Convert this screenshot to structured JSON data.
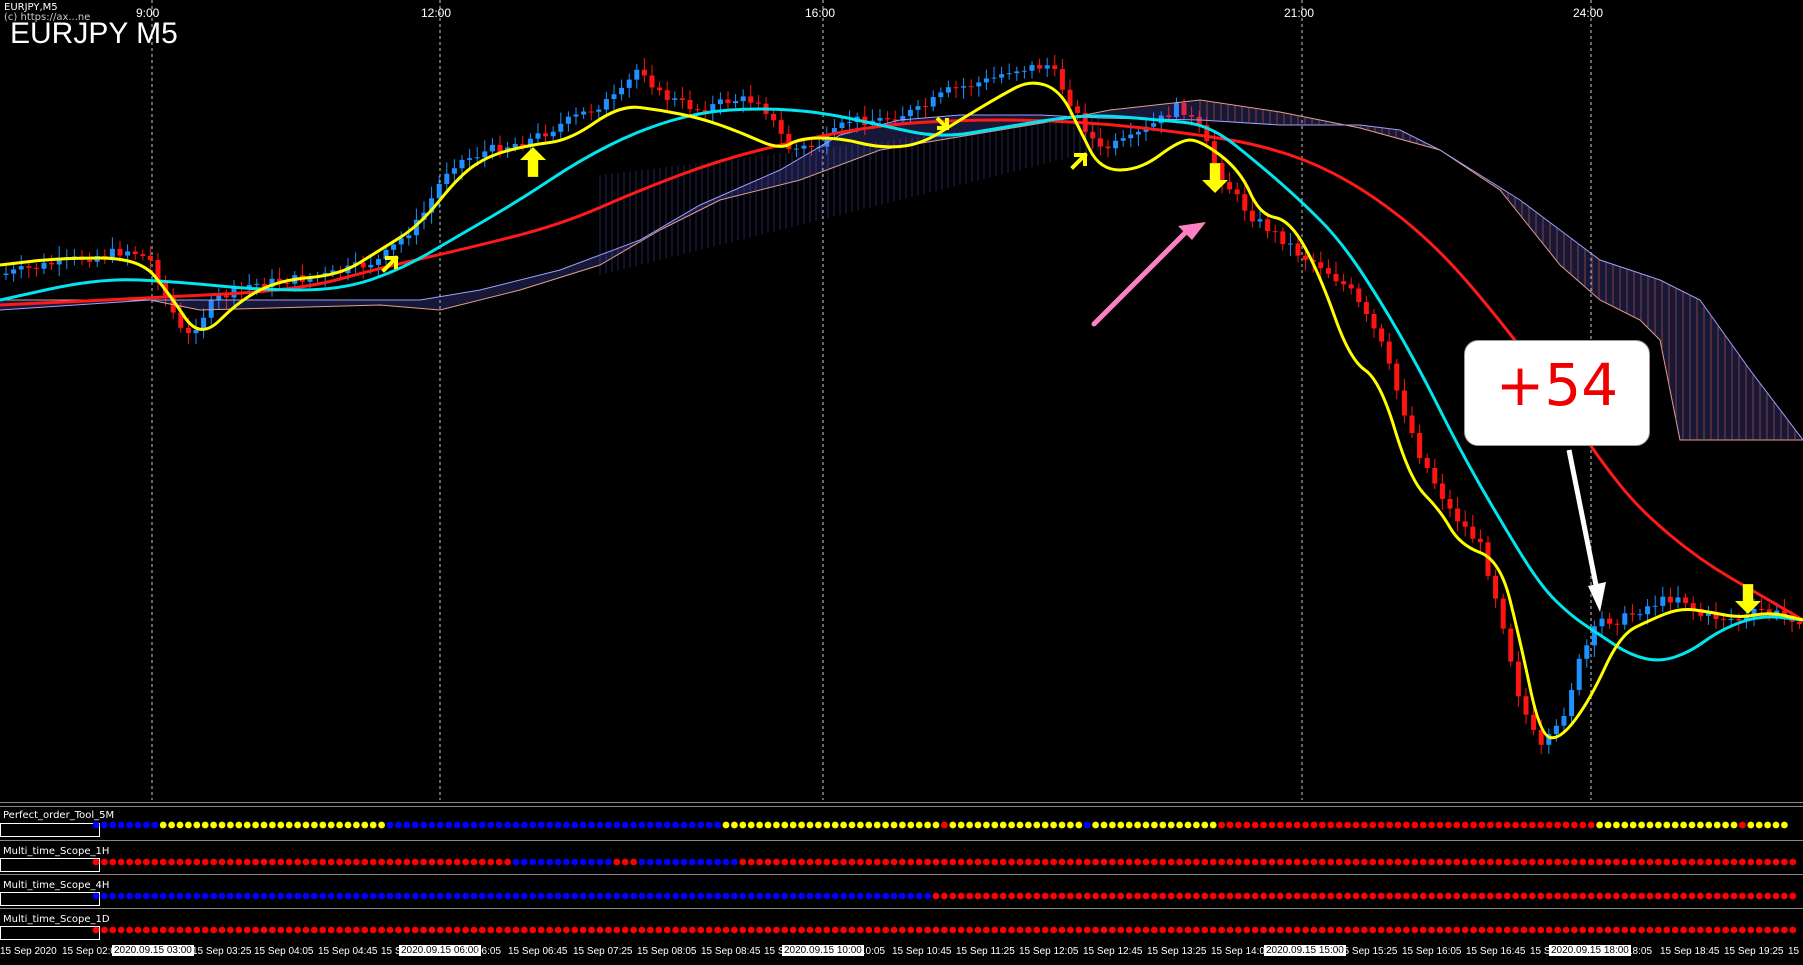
{
  "window": {
    "symbol_label": "EURJPY,M5",
    "copyright": "(c) https://ax...ne",
    "title": "EURJPY M5"
  },
  "time_labels": [
    "9:00",
    "12:00",
    "16:00",
    "21:00",
    "24:00"
  ],
  "callout": {
    "text": "+54"
  },
  "colors": {
    "bull": "#1e90ff",
    "bear": "#ff1414",
    "ma_fast": "#ffff00",
    "ma_mid": "#00e5ee",
    "ma_slow": "#ff1a1a",
    "cloud_up": "#6a6aff",
    "cloud_down": "#d06040",
    "dot_blue": "#0000ff",
    "dot_yellow": "#ffff00",
    "dot_red": "#ff0000"
  },
  "subwindows": [
    {
      "label": "Perfect_order_Tool_5M",
      "segments": [
        [
          "blue",
          8
        ],
        [
          "yellow",
          27
        ],
        [
          "blue",
          40
        ],
        [
          "yellow",
          26
        ],
        [
          "red",
          1
        ],
        [
          "yellow",
          16
        ],
        [
          "blue",
          1
        ],
        [
          "yellow",
          15
        ],
        [
          "red",
          45
        ],
        [
          "yellow",
          17
        ],
        [
          "red",
          1
        ],
        [
          "yellow",
          5
        ]
      ]
    },
    {
      "label": "Multi_time_Scope_1H",
      "segments": [
        [
          "red",
          50
        ],
        [
          "blue",
          12
        ],
        [
          "red",
          3
        ],
        [
          "blue",
          12
        ],
        [
          "red",
          126
        ]
      ]
    },
    {
      "label": "Multi_time_Scope_4H",
      "segments": [
        [
          "blue",
          100
        ],
        [
          "red",
          103
        ]
      ]
    },
    {
      "label": "Multi_time_Scope_1D",
      "segments": [
        [
          "red",
          203
        ]
      ]
    }
  ],
  "x_axis": [
    {
      "text": "15 Sep 2020",
      "boxed": false
    },
    {
      "text": "15 Sep 02:05",
      "boxed": false
    },
    {
      "text": "2020.09.15 03:00",
      "boxed": true
    },
    {
      "text": "15 Sep 03:25",
      "boxed": false
    },
    {
      "text": "15 Sep 04:05",
      "boxed": false
    },
    {
      "text": "15 Sep 04:45",
      "boxed": false
    },
    {
      "text": "15 S",
      "boxed": false
    },
    {
      "text": "2020.09.15 06:00",
      "boxed": true
    },
    {
      "text": "06:05",
      "boxed": false
    },
    {
      "text": "15 Sep 06:45",
      "boxed": false
    },
    {
      "text": "15 Sep 07:25",
      "boxed": false
    },
    {
      "text": "15 Sep 08:05",
      "boxed": false
    },
    {
      "text": "15 Sep 08:45",
      "boxed": false
    },
    {
      "text": "15 S",
      "boxed": false
    },
    {
      "text": "2020.09.15 10:00",
      "boxed": true
    },
    {
      "text": "10:05",
      "boxed": false
    },
    {
      "text": "15 Sep 10:45",
      "boxed": false
    },
    {
      "text": "15 Sep 11:25",
      "boxed": false
    },
    {
      "text": "15 Sep 12:05",
      "boxed": false
    },
    {
      "text": "15 Sep 12:45",
      "boxed": false
    },
    {
      "text": "15 Sep 13:25",
      "boxed": false
    },
    {
      "text": "15 Sep 14:0",
      "boxed": false
    },
    {
      "text": "2020.09.15 15:00",
      "boxed": true
    },
    {
      "text": "15 Sep 15:25",
      "boxed": false
    },
    {
      "text": "15 Sep 16:05",
      "boxed": false
    },
    {
      "text": "15 Sep 16:45",
      "boxed": false
    },
    {
      "text": "15 S",
      "boxed": false
    },
    {
      "text": "2020.09.15 18:00",
      "boxed": true
    },
    {
      "text": "18:05",
      "boxed": false
    },
    {
      "text": "15 Sep 18:45",
      "boxed": false
    },
    {
      "text": "15 Sep 19:25",
      "boxed": false
    },
    {
      "text": "15",
      "boxed": false
    }
  ]
}
